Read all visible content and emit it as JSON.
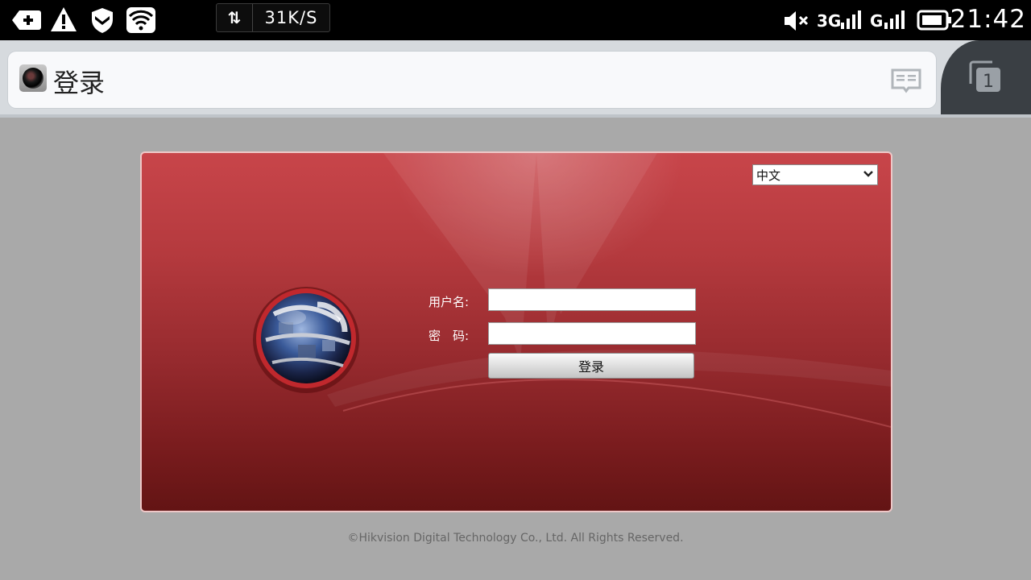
{
  "status_bar": {
    "net_speed": "31K/S",
    "net_type_a": "3G",
    "net_type_b": "G",
    "time": "21:42"
  },
  "browser": {
    "page_title": "登录",
    "tab_count": "1"
  },
  "login": {
    "language_selected": "中文",
    "username_label": "用户名:",
    "password_label": "密　码:",
    "login_button": "登录",
    "username_value": "",
    "password_value": ""
  },
  "footer": {
    "copyright": "©Hikvision Digital Technology Co., Ltd. All Rights Reserved."
  },
  "colors": {
    "panel_red": "#b53a3e",
    "panel_dark": "#631414",
    "page_bg": "#a9a9a9"
  }
}
